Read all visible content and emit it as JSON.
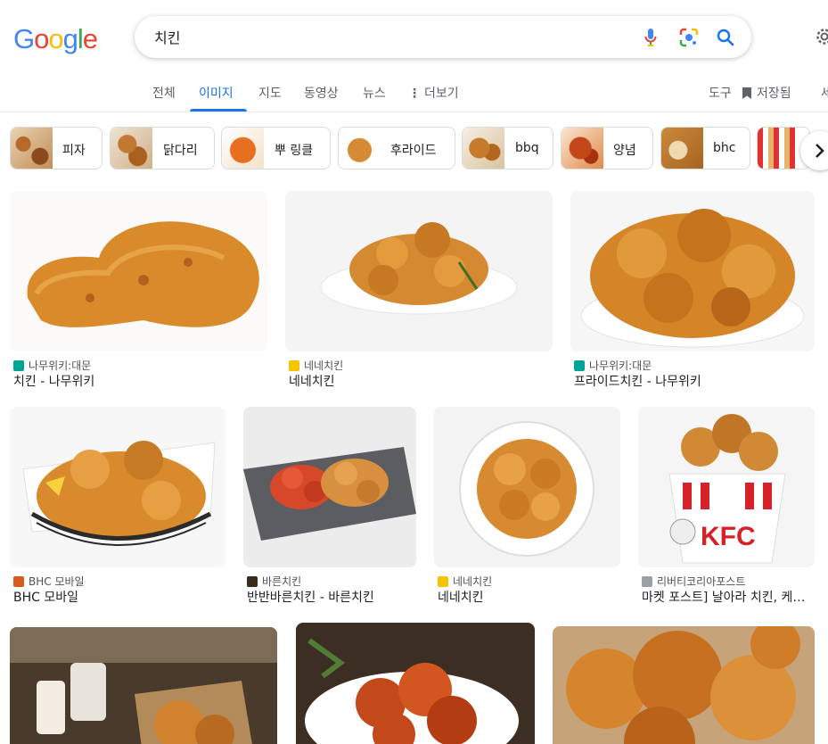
{
  "logo": {
    "text": "Google"
  },
  "search": {
    "value": "치킨"
  },
  "tabs": [
    {
      "label": "전체",
      "active": false
    },
    {
      "label": "이미지",
      "active": true
    },
    {
      "label": "지도",
      "active": false
    },
    {
      "label": "동영상",
      "active": false
    },
    {
      "label": "뉴스",
      "active": false
    },
    {
      "label": "더보기",
      "active": false
    }
  ],
  "tools": {
    "tools_label": "도구",
    "saved_label": "저장됨"
  },
  "chips": [
    {
      "label": "피자"
    },
    {
      "label": "닭다리"
    },
    {
      "label": "뿌 링클"
    },
    {
      "label": "후라이드"
    },
    {
      "label": "bbq"
    },
    {
      "label": "양념"
    },
    {
      "label": "bhc"
    }
  ],
  "results": [
    {
      "source": "나무위키:대문",
      "title": "치킨 - 나무위키"
    },
    {
      "source": "네네치킨",
      "title": "네네치킨"
    },
    {
      "source": "나무위키:대문",
      "title": "프라이드치킨 - 나무위키"
    },
    {
      "source": "BHC 모바일",
      "title": "BHC 모바일"
    },
    {
      "source": "바른치킨",
      "title": "반반바른치킨 - 바른치킨"
    },
    {
      "source": "네네치킨",
      "title": "네네치킨"
    },
    {
      "source": "리버티코리아포스트",
      "title": "마켓 포스트] 날아라 치킨, 케…"
    }
  ],
  "colors": {
    "accent": "#1a73e8",
    "chicken": "#d98a2b",
    "chicken_dark": "#a8561a"
  }
}
